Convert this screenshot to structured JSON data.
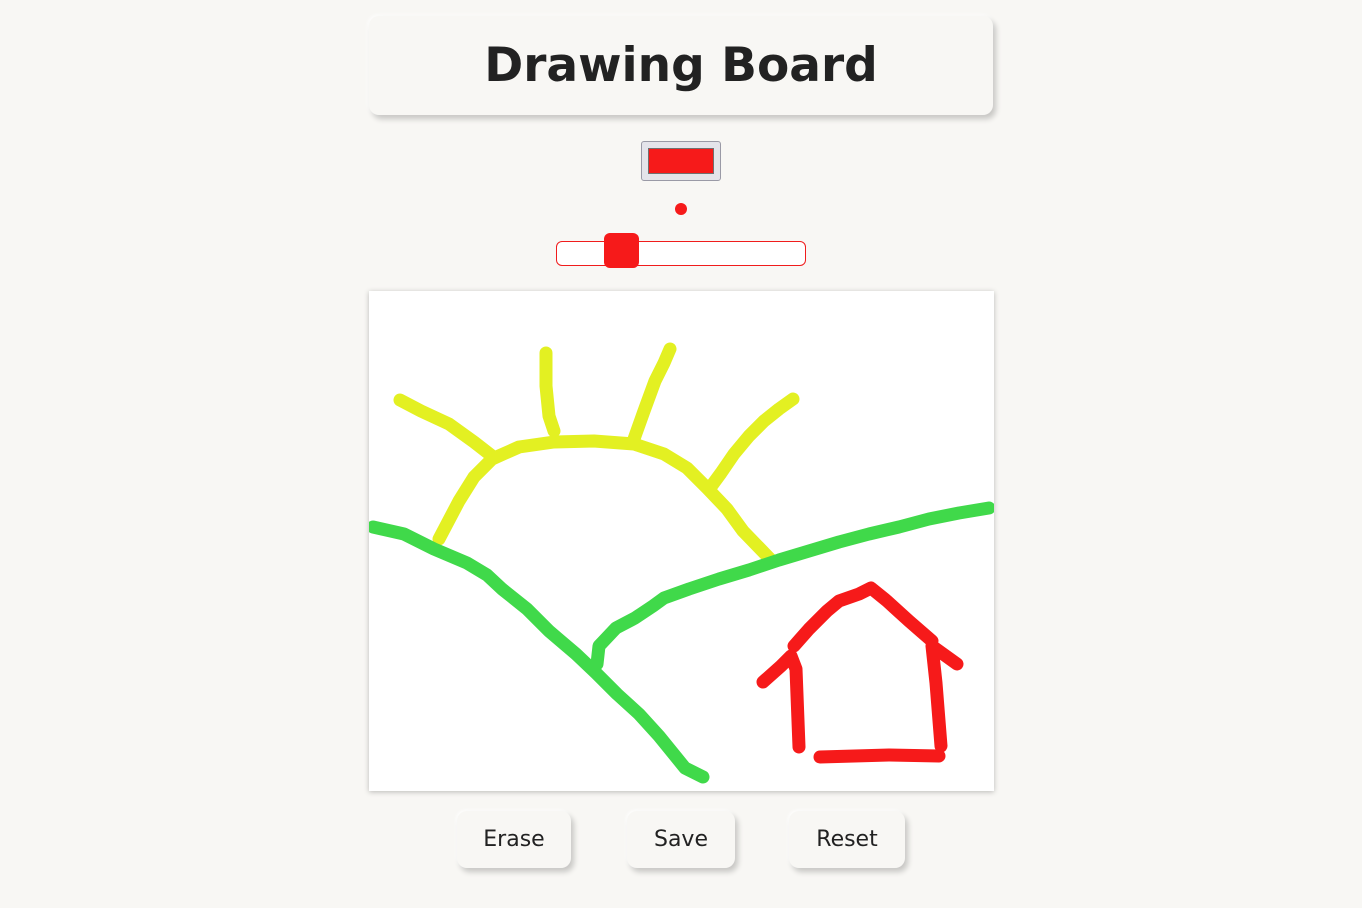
{
  "title": "Drawing Board",
  "brush": {
    "color": "#f61a1a",
    "size_slider_value": 0.22
  },
  "canvas": {
    "background": "#ffffff",
    "strokes": [
      {
        "name": "sun-arc",
        "color": "#e3f022"
      },
      {
        "name": "sun-ray-1",
        "color": "#e3f022"
      },
      {
        "name": "sun-ray-2",
        "color": "#e3f022"
      },
      {
        "name": "sun-ray-3",
        "color": "#e3f022"
      },
      {
        "name": "sun-ray-4",
        "color": "#e3f022"
      },
      {
        "name": "hill-left",
        "color": "#40d94a"
      },
      {
        "name": "hill-right",
        "color": "#40d94a"
      },
      {
        "name": "house",
        "color": "#f61a1a"
      }
    ]
  },
  "buttons": {
    "erase": "Erase",
    "save": "Save",
    "reset": "Reset"
  }
}
